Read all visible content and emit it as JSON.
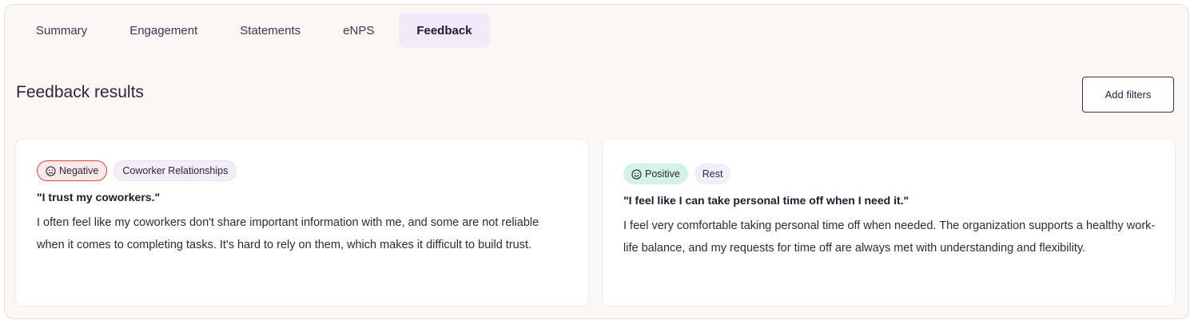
{
  "tabs": [
    {
      "label": "Summary",
      "active": false
    },
    {
      "label": "Engagement",
      "active": false
    },
    {
      "label": "Statements",
      "active": false
    },
    {
      "label": "eNPS",
      "active": false
    },
    {
      "label": "Feedback",
      "active": true
    }
  ],
  "section": {
    "title": "Feedback results",
    "add_filters_label": "Add filters"
  },
  "cards": [
    {
      "sentiment": "Negative",
      "sentiment_icon": "sad-face-icon",
      "category": "Coworker Relationships",
      "quote": "\"I trust my coworkers.\"",
      "text": "I often feel like my coworkers don't share important information with me, and some are not reliable when it comes to completing tasks. It's hard to rely on them, which makes it difficult to build trust."
    },
    {
      "sentiment": "Positive",
      "sentiment_icon": "smile-face-icon",
      "category": "Rest",
      "quote": "\"I feel like I can take personal time off when I need it.\"",
      "text": "I feel very comfortable taking personal time off when needed. The organization supports a healthy work-life balance, and my requests for time off are always met with understanding and flexibility."
    }
  ],
  "colors": {
    "negative_border": "#d9493e",
    "negative_bg": "#fde9e7",
    "positive_bg": "#d3f3e4",
    "active_tab_bg": "#efebf9"
  }
}
